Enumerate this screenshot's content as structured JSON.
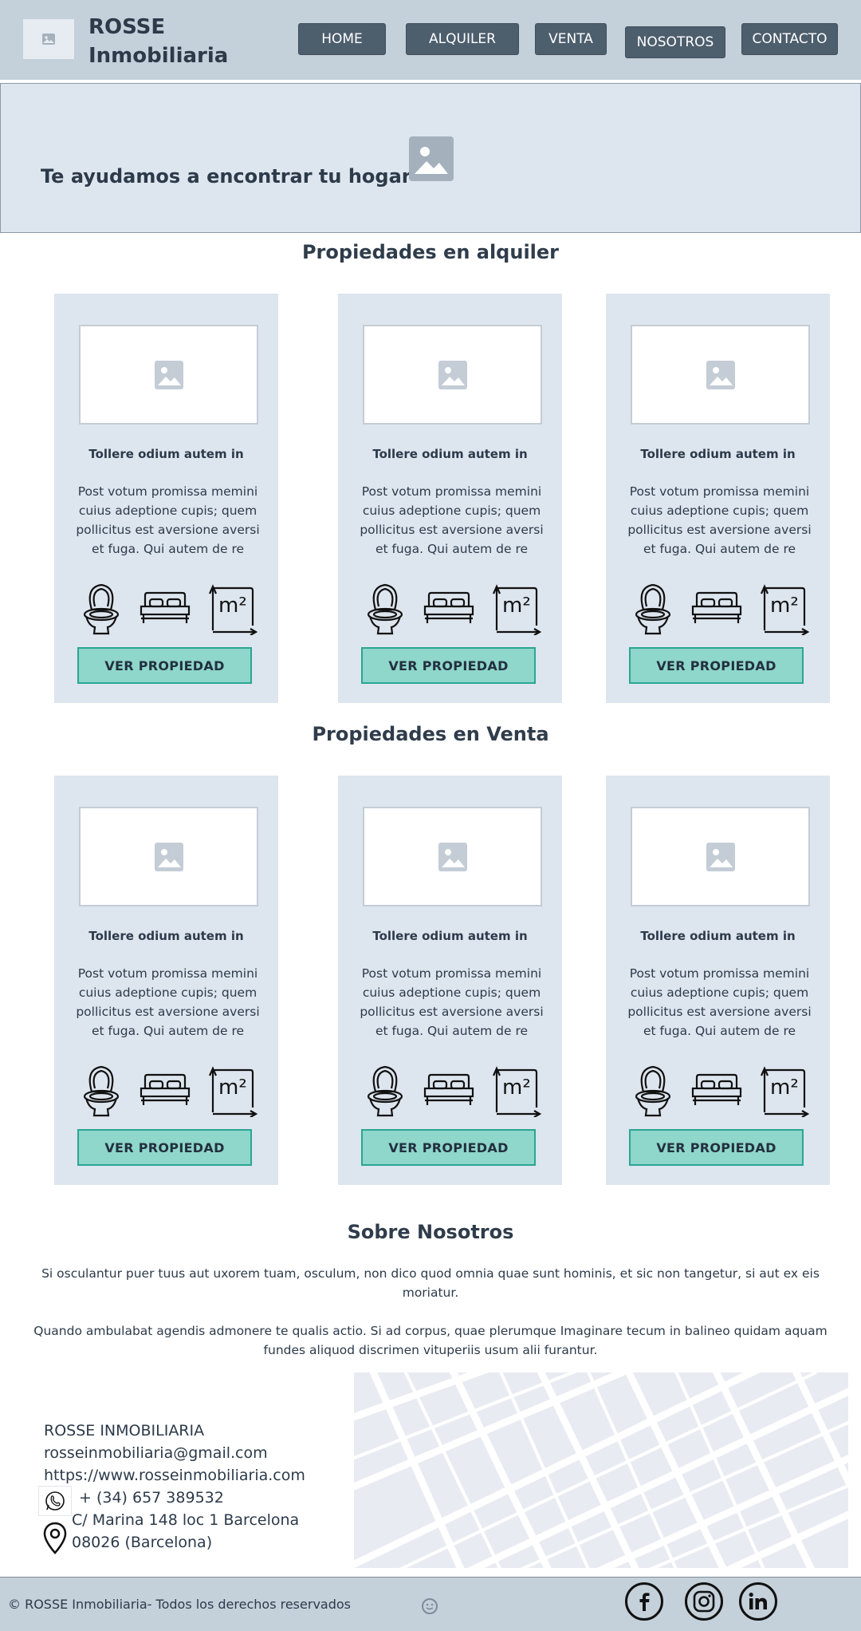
{
  "header": {
    "brand_line1": "ROSSE",
    "brand_line2": "Inmobiliaria",
    "nav": [
      "HOME",
      "ALQUILER",
      "VENTA",
      "NOSOTROS",
      "CONTACTO"
    ]
  },
  "hero": {
    "title": "Te ayudamos a encontrar tu hogar"
  },
  "rental": {
    "title": "Propiedades en alquiler",
    "cards": [
      {
        "title": "Tollere odium autem in",
        "text": "Post votum promissa memini cuius adeptione cupis; quem pollicitus est aversione aversi et fuga. Qui autem de re desit",
        "button": "VER PROPIEDAD"
      },
      {
        "title": "Tollere odium autem in",
        "text": "Post votum promissa memini cuius adeptione cupis; quem pollicitus est aversione aversi et fuga. Qui autem de re desit",
        "button": "VER PROPIEDAD"
      },
      {
        "title": "Tollere odium autem in",
        "text": "Post votum promissa memini cuius adeptione cupis; quem pollicitus est aversione aversi et fuga. Qui autem de re desit",
        "button": "VER PROPIEDAD"
      }
    ]
  },
  "sale": {
    "title": "Propiedades en Venta",
    "cards": [
      {
        "title": "Tollere odium autem in",
        "text": "Post votum promissa memini cuius adeptione cupis; quem pollicitus est aversione aversi et fuga. Qui autem de re desit",
        "button": "VER PROPIEDAD"
      },
      {
        "title": "Tollere odium autem in",
        "text": "Post votum promissa memini cuius adeptione cupis; quem pollicitus est aversione aversi et fuga. Qui autem de re desit",
        "button": "VER PROPIEDAD"
      },
      {
        "title": "Tollere odium autem in",
        "text": "Post votum promissa memini cuius adeptione cupis; quem pollicitus est aversione aversi et fuga. Qui autem de re desit",
        "button": "VER PROPIEDAD"
      }
    ]
  },
  "card_icons": {
    "area_label": "m²"
  },
  "about": {
    "title": "Sobre Nosotros",
    "paragraphs": [
      "Si osculantur puer tuus aut uxorem tuam, osculum, non dico quod omnia quae sunt hominis, et sic non tangetur, si aut ex eis moriatur.",
      "Quando ambulabat agendis admonere te qualis actio. Si ad corpus, quae plerumque Imaginare tecum in balineo quidam aquam fundes aliquod discrimen vituperiis usum alii furantur."
    ]
  },
  "contact": {
    "company": "ROSSE INMOBILIARIA",
    "email": "rosseinmobiliaria@gmail.com",
    "website": "https://www.rosseinmobiliaria.com",
    "phone": "+ (34) 657 389532",
    "address_line1": "C/ Marina 148 loc 1 Barcelona",
    "address_line2": "08026 (Barcelona)"
  },
  "footer": {
    "copyright": "© ROSSE Inmobiliaria- Todos los derechos reservados",
    "social": [
      "facebook-icon",
      "instagram-icon",
      "linkedin-icon"
    ]
  },
  "colors": {
    "header_bg": "#c4d0da",
    "nav_button": "#4d5e6d",
    "card_bg": "#dde5ee",
    "cta_bg": "#8fd6cb",
    "cta_border": "#2aa694"
  }
}
